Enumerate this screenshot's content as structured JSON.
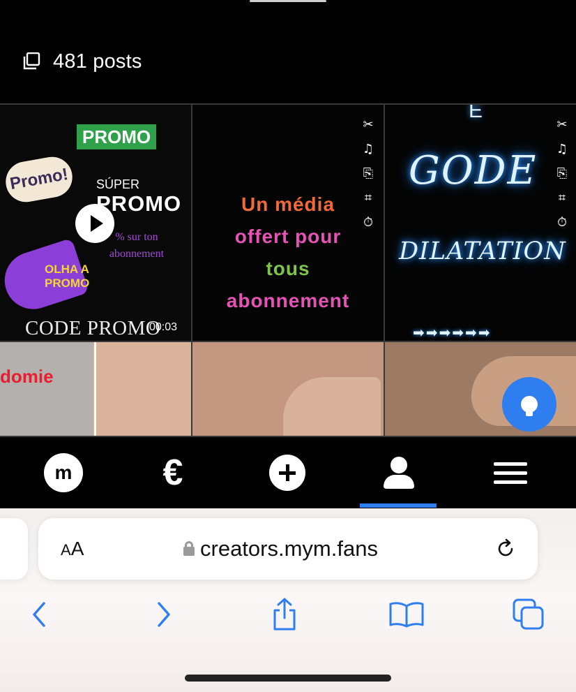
{
  "header": {
    "posts_label": "481 posts"
  },
  "grid": {
    "tile_1": {
      "badge": "PROMO",
      "cloud": "Promo!",
      "super": "SÚPER",
      "super_big": "PROMO",
      "sub": "% sur ton abonnement",
      "olha_line1": "OLHA A",
      "olha_line2": "PROMO",
      "code": "CODE PROMO",
      "duration": "00:03"
    },
    "tile_2": {
      "line_1": "Un média",
      "line_2": "offert pour",
      "line_3": "tous",
      "line_4": "abonnement"
    },
    "tile_3": {
      "top": "E",
      "gode": "GODE",
      "dilatation": "DILATATION",
      "arrows": "➡➡➡➡➡➡"
    },
    "tile_4": {
      "red_word": "domie"
    },
    "tools": [
      "✂",
      "♫",
      "⎘",
      "⌗",
      "⏱"
    ]
  },
  "tabbar": {
    "m_logo": "m",
    "euro": "€",
    "active_tab": "profile"
  },
  "browser": {
    "text_size_label_small": "A",
    "text_size_label_big": "A",
    "url": "creators.mym.fans"
  },
  "colors": {
    "accent": "#2f7ef0",
    "promo_green": "#2fa14a"
  }
}
